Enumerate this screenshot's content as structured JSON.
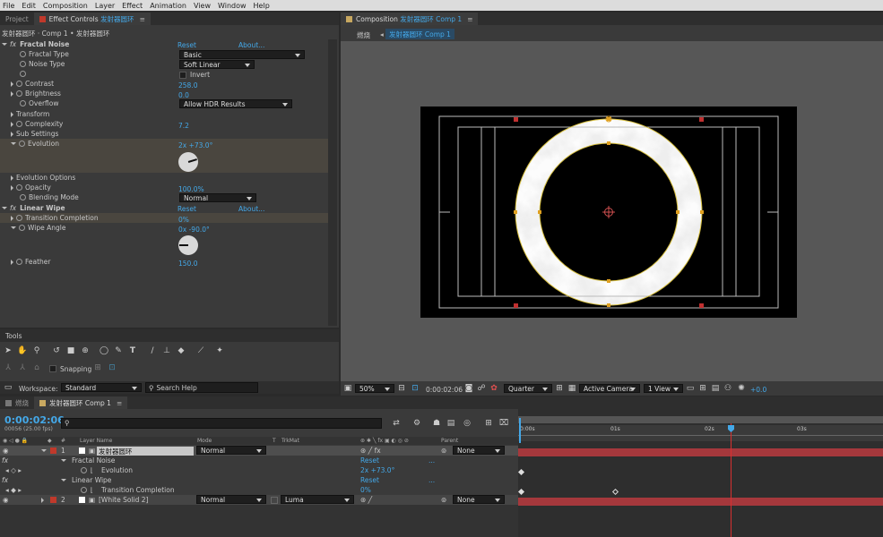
{
  "menu": [
    "File",
    "Edit",
    "Composition",
    "Layer",
    "Effect",
    "Animation",
    "View",
    "Window",
    "Help"
  ],
  "left_tabs": {
    "project": "Project",
    "effect_prefix": "Effect Controls",
    "effect_name": "发射器圆环"
  },
  "breadcrumb": "发射器圆环 · Comp 1 • 发射器圆环",
  "fractal": {
    "name": "Fractal Noise",
    "reset": "Reset",
    "about": "About...",
    "fractal_type_label": "Fractal Type",
    "fractal_type": "Basic",
    "noise_type_label": "Noise Type",
    "noise_type": "Soft Linear",
    "invert": "Invert",
    "contrast_label": "Contrast",
    "contrast": "258.0",
    "brightness_label": "Brightness",
    "brightness": "0.0",
    "overflow_label": "Overflow",
    "overflow": "Allow HDR Results",
    "transform": "Transform",
    "complexity_label": "Complexity",
    "complexity": "7.2",
    "sub_settings": "Sub Settings",
    "evolution_label": "Evolution",
    "evolution": "2x +73.0°",
    "evolution_options": "Evolution Options",
    "opacity_label": "Opacity",
    "opacity": "100.0%",
    "blending_label": "Blending Mode",
    "blending": "Normal"
  },
  "linear": {
    "name": "Linear Wipe",
    "reset": "Reset",
    "about": "About...",
    "completion_label": "Transition Completion",
    "completion": "0%",
    "angle_label": "Wipe Angle",
    "angle": "0x -90.0°",
    "feather_label": "Feather",
    "feather": "150.0"
  },
  "tools": {
    "title": "Tools",
    "snapping": "Snapping",
    "workspace_label": "Workspace:",
    "workspace": "Standard",
    "search": "Search Help"
  },
  "comp": {
    "tab_prefix": "Composition",
    "tab_name": "发射器圆环",
    "tab_comp": "Comp 1",
    "flow_a": "燃烧",
    "flow_b": "发射器圆环",
    "flow_c": "Comp 1",
    "zoom": "50%",
    "time": "0:00:02:06",
    "resolution": "Quarter",
    "camera": "Active Camera",
    "views": "1 View",
    "exposure": "+0.0"
  },
  "timeline": {
    "tab_a": "燃烧",
    "tab_b": "发射器圆环",
    "tab_c": "Comp 1",
    "time": "0:00:02:06",
    "frames": "00056 (25.00 fps)",
    "col_layer": "Layer Name",
    "col_mode": "Mode",
    "col_t": "T",
    "col_trkmat": "TrkMat",
    "col_parent": "Parent",
    "ticks": [
      "0:00s",
      "01s",
      "02s",
      "03s"
    ],
    "layer1": {
      "num": "1",
      "name": "发射器圆环",
      "mode": "Normal",
      "parent": "None"
    },
    "fx1": "Fractal Noise",
    "fx1_reset": "Reset",
    "fx1_dots": "...",
    "evo_label": "Evolution",
    "evo_val": "2x +73.0°",
    "fx2": "Linear Wipe",
    "fx2_reset": "Reset",
    "fx2_dots": "...",
    "tc_label": "Transition Completion",
    "tc_val": "0%",
    "layer2": {
      "num": "2",
      "name": "[White Solid 2]",
      "mode": "Normal",
      "trkmat": "Luma",
      "parent": "None"
    }
  },
  "colors": {
    "accent": "#44a8e8",
    "layer_bar": "#a5383c",
    "label_red": "#c0392b"
  }
}
